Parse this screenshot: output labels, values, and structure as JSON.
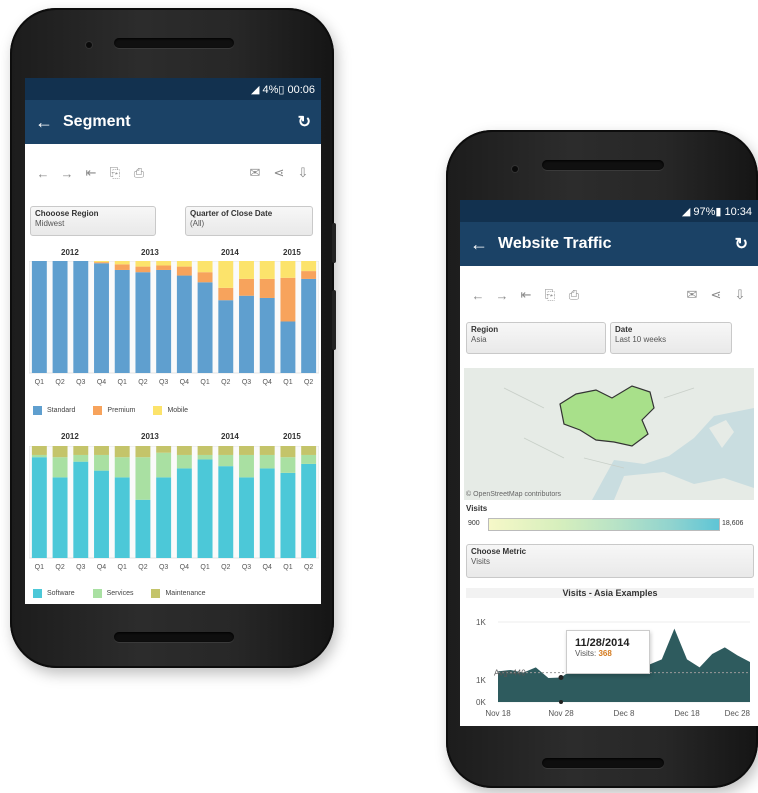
{
  "phone1": {
    "status": "◢ 4%▯ 00:06",
    "title": "Segment",
    "back_icon": "arrow-left-icon",
    "refresh_icon": "refresh-icon",
    "filters": [
      {
        "label": "Chooose Region",
        "value": "Midwest"
      },
      {
        "label": "Quarter of Close Date",
        "value": "(All)"
      }
    ],
    "years": [
      "2012",
      "2013",
      "2014",
      "2015"
    ],
    "quarters": [
      "Q1",
      "Q2",
      "Q3",
      "Q4",
      "Q1",
      "Q2",
      "Q3",
      "Q4",
      "Q1",
      "Q2",
      "Q3",
      "Q4",
      "Q1",
      "Q2"
    ],
    "legend1": [
      {
        "label": "Standard",
        "color": "#5f9fcf"
      },
      {
        "label": "Premium",
        "color": "#f7a35c"
      },
      {
        "label": "Mobile",
        "color": "#fce36b"
      }
    ],
    "legend2": [
      {
        "label": "Software",
        "color": "#4cc8d8"
      },
      {
        "label": "Services",
        "color": "#a9e0a2"
      },
      {
        "label": "Maintenance",
        "color": "#c4c46a"
      }
    ]
  },
  "phone2": {
    "status": "◢ 97%▮ 10:34",
    "title": "Website Traffic",
    "filters": [
      {
        "label": "Region",
        "value": "Asia"
      },
      {
        "label": "Date",
        "value": "Last 10 weeks"
      }
    ],
    "map_credit": "© OpenStreetMap contributors",
    "visits_label": "Visits",
    "visits_min": "900",
    "visits_max": "18,606",
    "metric_label": "Choose Metric",
    "metric_value": "Visits",
    "chart_title": "Visits - Asia Examples",
    "y_ticks": [
      "1K",
      "1K",
      "0K"
    ],
    "avg_label": "Avg=440",
    "x_ticks": [
      "Nov 18",
      "Nov 28",
      "Dec 8",
      "Dec 18",
      "Dec 28"
    ],
    "tooltip_date": "11/28/2014",
    "tooltip_label": "Visits:",
    "tooltip_value": "368"
  },
  "chart_data": [
    {
      "type": "bar",
      "title": "",
      "categories": [
        "2012 Q1",
        "2012 Q2",
        "2012 Q3",
        "2012 Q4",
        "2013 Q1",
        "2013 Q2",
        "2013 Q3",
        "2013 Q4",
        "2014 Q1",
        "2014 Q2",
        "2014 Q3",
        "2014 Q4",
        "2015 Q1",
        "2015 Q2"
      ],
      "stacked": true,
      "series": [
        {
          "name": "Standard",
          "values": [
            100,
            100,
            100,
            98,
            92,
            90,
            92,
            87,
            81,
            65,
            69,
            67,
            46,
            84
          ]
        },
        {
          "name": "Premium",
          "values": [
            0,
            0,
            0,
            1,
            5,
            5,
            4,
            8,
            9,
            11,
            15,
            17,
            39,
            7
          ]
        },
        {
          "name": "Mobile",
          "values": [
            0,
            0,
            0,
            1,
            3,
            5,
            4,
            5,
            10,
            24,
            16,
            16,
            15,
            9
          ]
        }
      ],
      "ylim": [
        0,
        100
      ]
    },
    {
      "type": "bar",
      "title": "",
      "categories": [
        "2012 Q1",
        "2012 Q2",
        "2012 Q3",
        "2012 Q4",
        "2013 Q1",
        "2013 Q2",
        "2013 Q3",
        "2013 Q4",
        "2014 Q1",
        "2014 Q2",
        "2014 Q3",
        "2014 Q4",
        "2015 Q1",
        "2015 Q2"
      ],
      "stacked": true,
      "series": [
        {
          "name": "Software",
          "values": [
            90,
            72,
            86,
            78,
            72,
            52,
            72,
            80,
            88,
            82,
            72,
            80,
            76,
            84
          ]
        },
        {
          "name": "Services",
          "values": [
            2,
            18,
            6,
            14,
            18,
            38,
            22,
            12,
            4,
            10,
            20,
            12,
            14,
            8
          ]
        },
        {
          "name": "Maintenance",
          "values": [
            8,
            10,
            8,
            8,
            10,
            10,
            6,
            8,
            8,
            8,
            8,
            8,
            10,
            8
          ]
        }
      ],
      "ylim": [
        0,
        100
      ]
    },
    {
      "type": "area",
      "title": "Visits - Asia Examples",
      "x": [
        "Nov 18",
        "Nov 20",
        "Nov 22",
        "Nov 24",
        "Nov 26",
        "Nov 28",
        "Nov 30",
        "Dec 2",
        "Dec 4",
        "Dec 6",
        "Dec 8",
        "Dec 10",
        "Dec 12",
        "Dec 14",
        "Dec 16",
        "Dec 18",
        "Dec 20",
        "Dec 22",
        "Dec 24",
        "Dec 26",
        "Dec 28"
      ],
      "series": [
        {
          "name": "Visits",
          "values": [
            460,
            480,
            440,
            520,
            360,
            368,
            500,
            420,
            520,
            600,
            520,
            700,
            560,
            640,
            1100,
            640,
            520,
            720,
            820,
            700,
            600
          ]
        }
      ],
      "avg": 440,
      "ylim": [
        0,
        1200
      ]
    }
  ]
}
